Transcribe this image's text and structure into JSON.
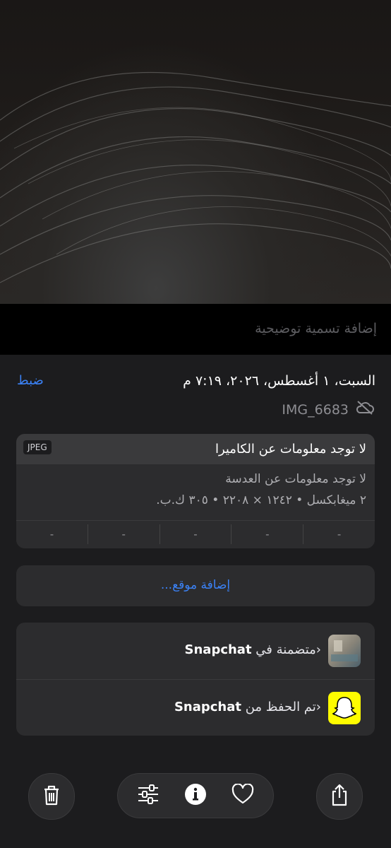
{
  "caption": {
    "placeholder": "إضافة تسمية توضيحية"
  },
  "info": {
    "date": "السبت، ١ أغسطس، ٢٠٢٦، ٧:١٩ م",
    "adjust_label": "ضبط",
    "filename": "IMG_6683"
  },
  "exif": {
    "title": "لا توجد معلومات عن الكاميرا",
    "format_badge": "JPEG",
    "lens": "لا توجد معلومات عن العدسة",
    "specs": "٢ ميغابكسل • ١٢٤٢ × ٢٢٠٨ • ٣٠٥ ك.ب.",
    "values": [
      "-",
      "-",
      "-",
      "-",
      "-"
    ]
  },
  "location": {
    "add_label": "إضافة موقع..."
  },
  "apps": [
    {
      "prefix": "متضمنة في ",
      "app": "Snapchat"
    },
    {
      "prefix": "تم الحفظ من ",
      "app": "Snapchat"
    }
  ],
  "icons": {
    "cloud_off": "cloud-slash-icon",
    "trash": "trash-icon",
    "adjust": "sliders-icon",
    "info": "info-icon",
    "favorite": "heart-icon",
    "share": "share-icon"
  },
  "colors": {
    "accent": "#3b82f6",
    "snap_yellow": "#fffc00"
  }
}
